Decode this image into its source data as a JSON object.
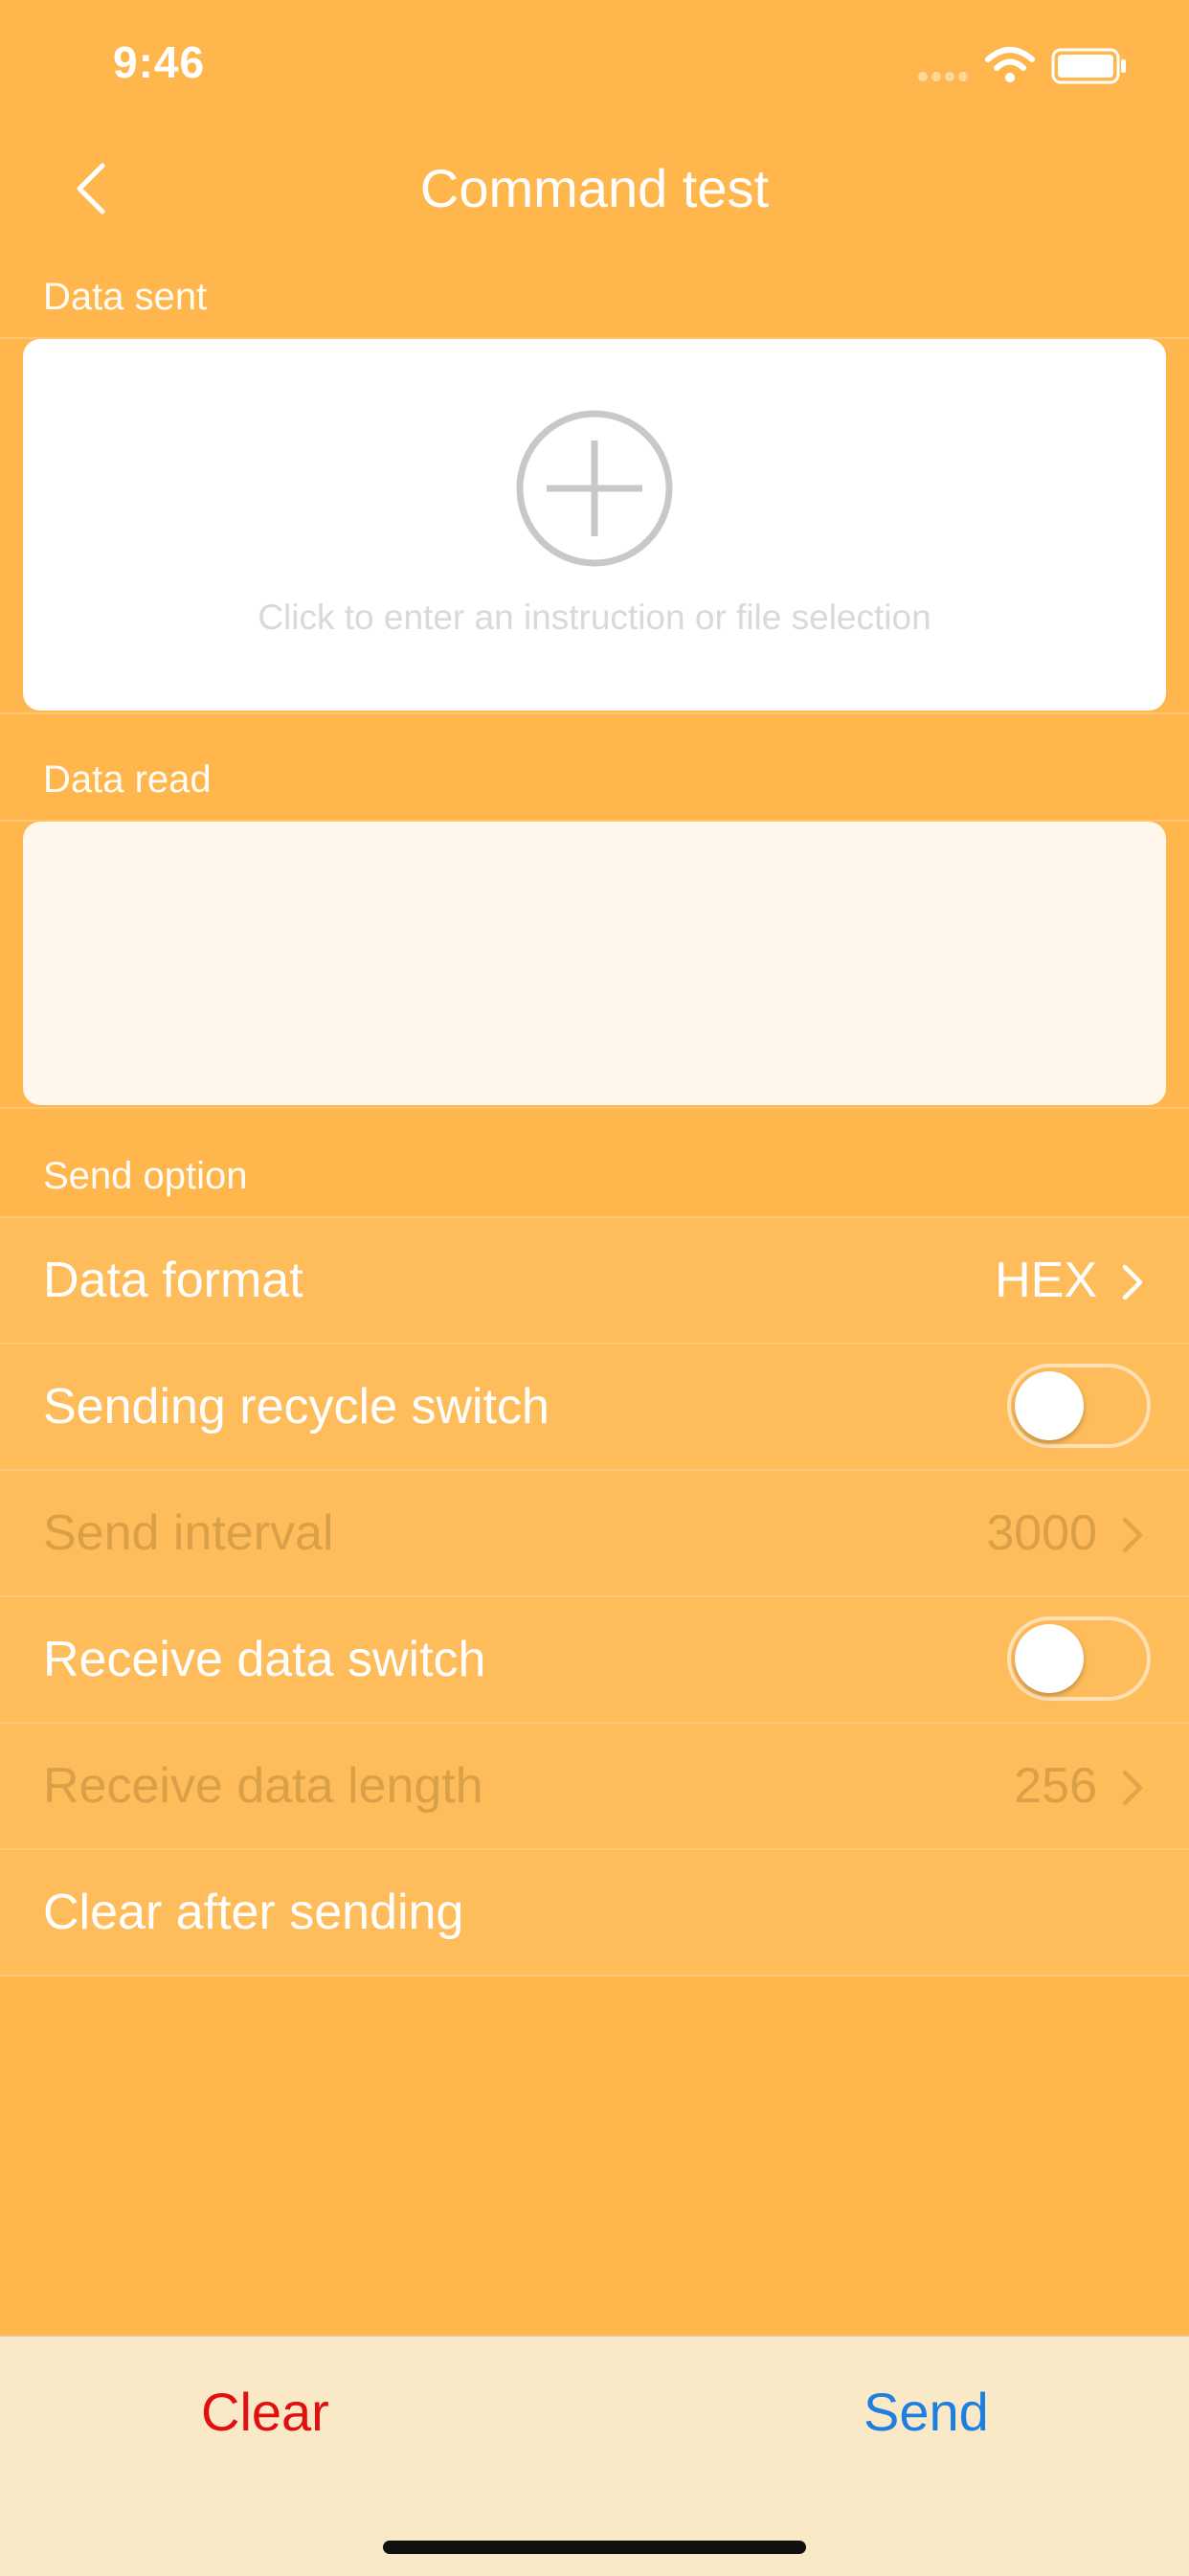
{
  "status_bar": {
    "time": "9:46",
    "icons": [
      "signal-icon",
      "wifi-icon",
      "battery-icon"
    ]
  },
  "nav": {
    "title": "Command test",
    "back_icon": "chevron-left-icon"
  },
  "sections": {
    "data_sent": {
      "label": "Data sent",
      "hint": "Click to enter an instruction or file selection",
      "icon": "add-circle-icon"
    },
    "data_read": {
      "label": "Data read",
      "content": ""
    },
    "send_option": {
      "label": "Send option"
    }
  },
  "options": {
    "data_format": {
      "label": "Data format",
      "value": "HEX"
    },
    "sending_recycle_switch": {
      "label": "Sending recycle switch",
      "on": false
    },
    "send_interval": {
      "label": "Send interval",
      "value": "3000",
      "disabled": true
    },
    "receive_data_switch": {
      "label": "Receive data switch",
      "on": false
    },
    "receive_data_length": {
      "label": "Receive data length",
      "value": "256",
      "disabled": true
    },
    "clear_after_sending": {
      "label": "Clear after sending"
    }
  },
  "bottom_bar": {
    "clear_label": "Clear",
    "send_label": "Send"
  },
  "colors": {
    "background": "#FFB74D",
    "clear": "#E01010",
    "send": "#1E7FE0",
    "bottom_bar": "#FAE9C7"
  }
}
